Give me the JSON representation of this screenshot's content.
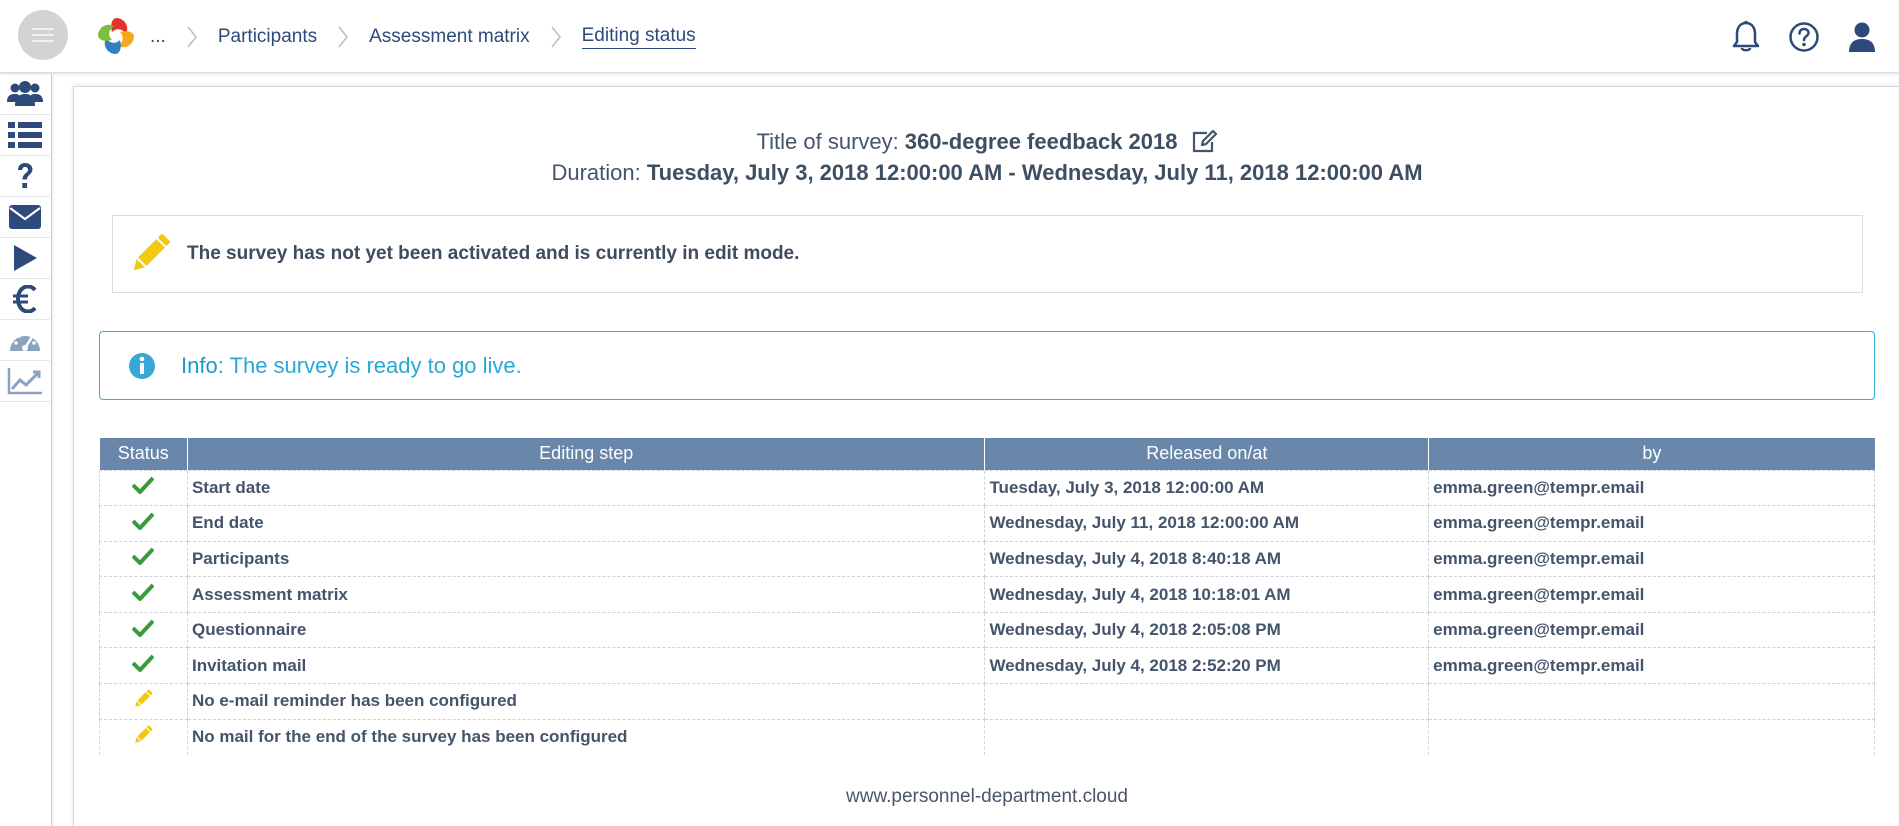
{
  "topbar": {
    "breadcrumb": {
      "ellipsis": "...",
      "items": [
        {
          "label": "Participants"
        },
        {
          "label": "Assessment matrix"
        },
        {
          "label": "Editing status"
        }
      ]
    },
    "icons": [
      "bell-icon",
      "help-circle-icon",
      "user-icon"
    ]
  },
  "sidebar": {
    "items": [
      {
        "icon": "users-icon"
      },
      {
        "icon": "list-icon"
      },
      {
        "icon": "question-icon"
      },
      {
        "icon": "envelope-icon"
      },
      {
        "icon": "play-icon"
      },
      {
        "icon": "euro-icon"
      },
      {
        "icon": "dashboard-icon"
      },
      {
        "icon": "chart-line-icon"
      }
    ]
  },
  "survey": {
    "title_label": "Title of survey:",
    "title_value": "360-degree feedback 2018",
    "duration_label": "Duration:",
    "duration_value": "Tuesday, July 3, 2018 12:00:00 AM - Wednesday, July 11, 2018 12:00:00 AM"
  },
  "edit_alert": {
    "text": "The survey has not yet been activated and is currently in edit mode."
  },
  "info_alert": {
    "label": "Info",
    "message": ": The survey is ready to go live."
  },
  "table": {
    "headers": [
      "Status",
      "Editing step",
      "Released on/at",
      "by"
    ],
    "rows": [
      {
        "status": "done",
        "step": "Start date",
        "released": "Tuesday, July 3, 2018 12:00:00 AM",
        "by": "emma.green@tempr.email"
      },
      {
        "status": "done",
        "step": "End date",
        "released": "Wednesday, July 11, 2018 12:00:00 AM",
        "by": "emma.green@tempr.email"
      },
      {
        "status": "done",
        "step": "Participants",
        "released": "Wednesday, July 4, 2018 8:40:18 AM",
        "by": "emma.green@tempr.email"
      },
      {
        "status": "done",
        "step": "Assessment matrix",
        "released": "Wednesday, July 4, 2018 10:18:01 AM",
        "by": "emma.green@tempr.email"
      },
      {
        "status": "done",
        "step": "Questionnaire",
        "released": "Wednesday, July 4, 2018 2:05:08 PM",
        "by": "emma.green@tempr.email"
      },
      {
        "status": "done",
        "step": "Invitation mail",
        "released": "Wednesday, July 4, 2018 2:52:20 PM",
        "by": "emma.green@tempr.email"
      },
      {
        "status": "pending",
        "step": "No e-mail reminder has been configured",
        "released": "",
        "by": ""
      },
      {
        "status": "pending",
        "step": "No mail for the end of the survey has been configured",
        "released": "",
        "by": ""
      }
    ]
  },
  "footer": {
    "text": "www.personnel-department.cloud"
  },
  "colors": {
    "header_bg": "#6987aa",
    "nav_blue": "#2d4a7a",
    "check_green": "#3a9b3e",
    "pencil_yellow": "#f2c811",
    "info_blue": "#29a8d8"
  }
}
